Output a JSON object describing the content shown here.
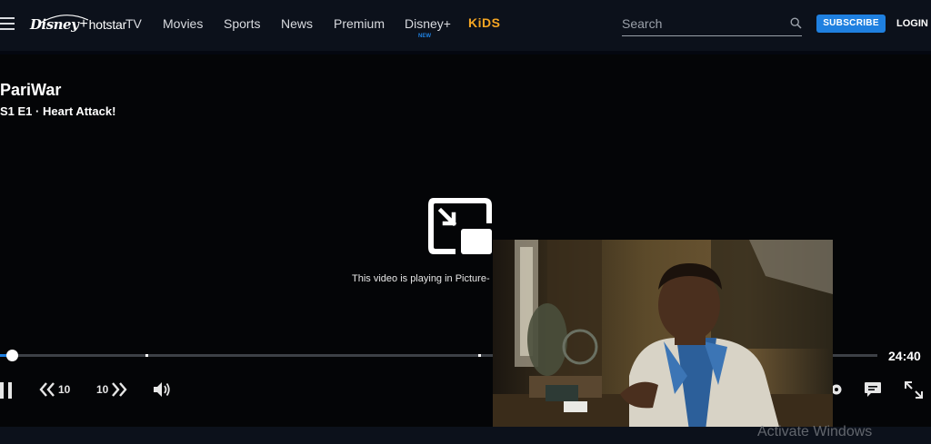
{
  "header": {
    "logo": {
      "disney": "Disney",
      "plus": "+",
      "hotstar": "hotstar"
    },
    "nav": [
      {
        "label": "TV"
      },
      {
        "label": "Movies"
      },
      {
        "label": "Sports"
      },
      {
        "label": "News"
      },
      {
        "label": "Premium"
      },
      {
        "label": "Disney+",
        "sub": "NEW"
      },
      {
        "label": "KiDS"
      }
    ],
    "search": {
      "placeholder": "Search"
    },
    "subscribe_label": "SUBSCRIBE",
    "login_label": "LOGIN"
  },
  "player": {
    "show_title": "PariWar",
    "episode_title": "S1 E1 · Heart Attack!",
    "pip_message": "This video is playing in Picture-",
    "progress": 0.01,
    "time_remaining": "24:40",
    "rewind_label": "10",
    "forward_label": "10"
  },
  "os_watermark": "Activate Windows",
  "colors": {
    "header_bg": "#0c111b",
    "accent": "#1f80e0",
    "kids": "#f5a623",
    "player_bg": "#040507"
  }
}
